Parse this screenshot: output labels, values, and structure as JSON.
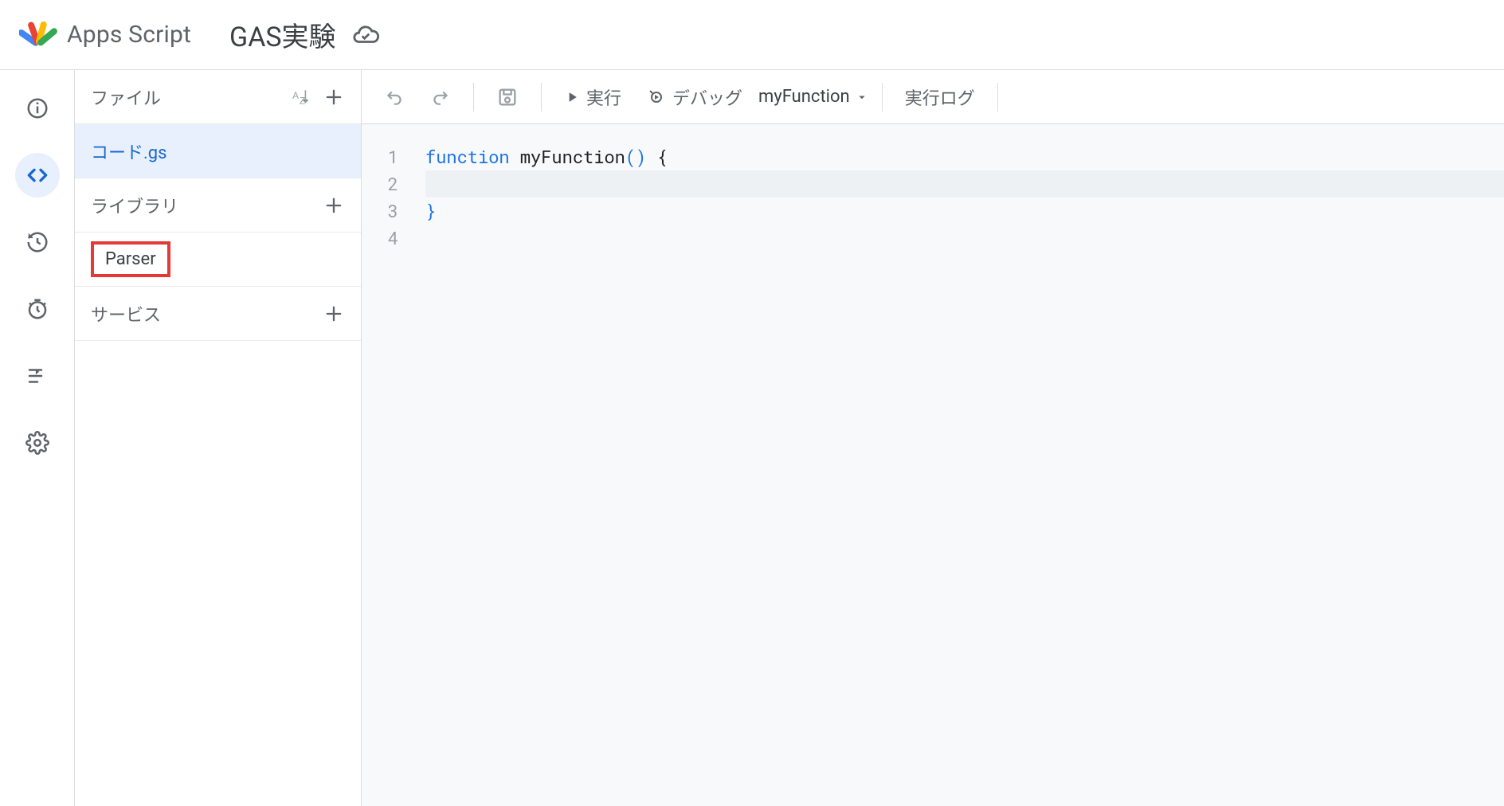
{
  "header": {
    "app_name": "Apps Script",
    "project_title": "GAS実験"
  },
  "sidebar": {
    "files_label": "ファイル",
    "libraries_label": "ライブラリ",
    "services_label": "サービス",
    "file_name": "コード.gs",
    "library_name": "Parser"
  },
  "toolbar": {
    "run_label": "実行",
    "debug_label": "デバッグ",
    "function_name": "myFunction",
    "log_label": "実行ログ"
  },
  "code": {
    "lines": [
      "1",
      "2",
      "3",
      "4"
    ],
    "l1_kw": "function",
    "l1_fn": " myFunction",
    "l1_paren": "()",
    "l1_brace": " {",
    "l3_brace": "}"
  }
}
